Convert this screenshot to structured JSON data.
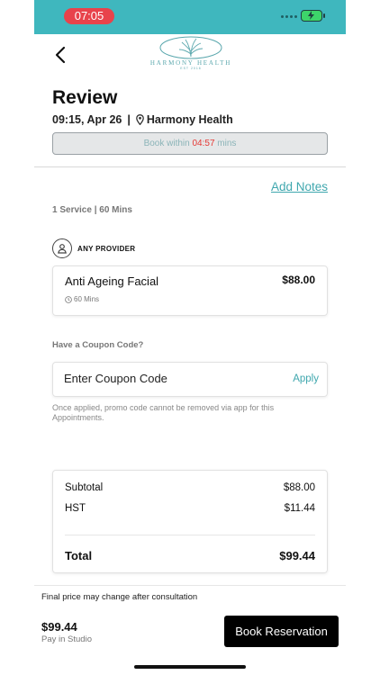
{
  "status_bar": {
    "time": "07:05"
  },
  "header": {
    "logo_text": "HARMONY HEALTH",
    "logo_sub": "EST 2016",
    "title": "Review",
    "time_date": "09:15, Apr 26",
    "location": "Harmony Health"
  },
  "timer": {
    "prefix": "Book within",
    "countdown": "04:57",
    "suffix": "mins"
  },
  "add_notes_label": "Add Notes",
  "service_summary": "1 Service | 60 Mins",
  "provider_label": "ANY PROVIDER",
  "service": {
    "name": "Anti Ageing Facial",
    "price": "$88.00",
    "duration": "60 Mins"
  },
  "coupon": {
    "question": "Have a Coupon Code?",
    "placeholder": "Enter Coupon Code",
    "apply_label": "Apply",
    "note": "Once applied, promo code cannot be removed via app for this Appointments."
  },
  "summary": {
    "subtotal_label": "Subtotal",
    "subtotal_value": "$88.00",
    "tax_label": "HST",
    "tax_value": "$11.44",
    "total_label": "Total",
    "total_value": "$99.44"
  },
  "footer": {
    "note": "Final price may change after consultation",
    "amount": "$99.44",
    "pay_method": "Pay in Studio",
    "book_label": "Book Reservation"
  },
  "colors": {
    "teal": "#3fb7be",
    "link": "#3fa7ae",
    "danger": "#e53935",
    "time_pill": "#e8434b",
    "button": "#000000"
  }
}
